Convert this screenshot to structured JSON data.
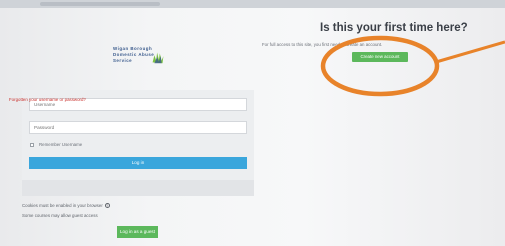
{
  "logo": {
    "line1": "Wigan Borough",
    "line2": "Domestic Abuse",
    "line3": "Service",
    "icon": "hands-logo-icon"
  },
  "signup": {
    "title": "Is this your first time here?",
    "description": "For full access to this site, you first need to create an account.",
    "button": "Create new account"
  },
  "login": {
    "username_placeholder": "Username",
    "password_placeholder": "Password",
    "remember_label": "Remember Username",
    "login_button": "Log in",
    "forgot_link": "Forgotten your username or password?"
  },
  "notes": {
    "cookies": "Cookies must be enabled in your browser",
    "help_icon": "help-icon",
    "guest_note": "Some courses may allow guest access",
    "guest_button": "Log in as a guest"
  },
  "colors": {
    "annotation": "#e8832a",
    "primary": "#3aa6dc",
    "success": "#5cb85c",
    "link": "#c9302c"
  }
}
